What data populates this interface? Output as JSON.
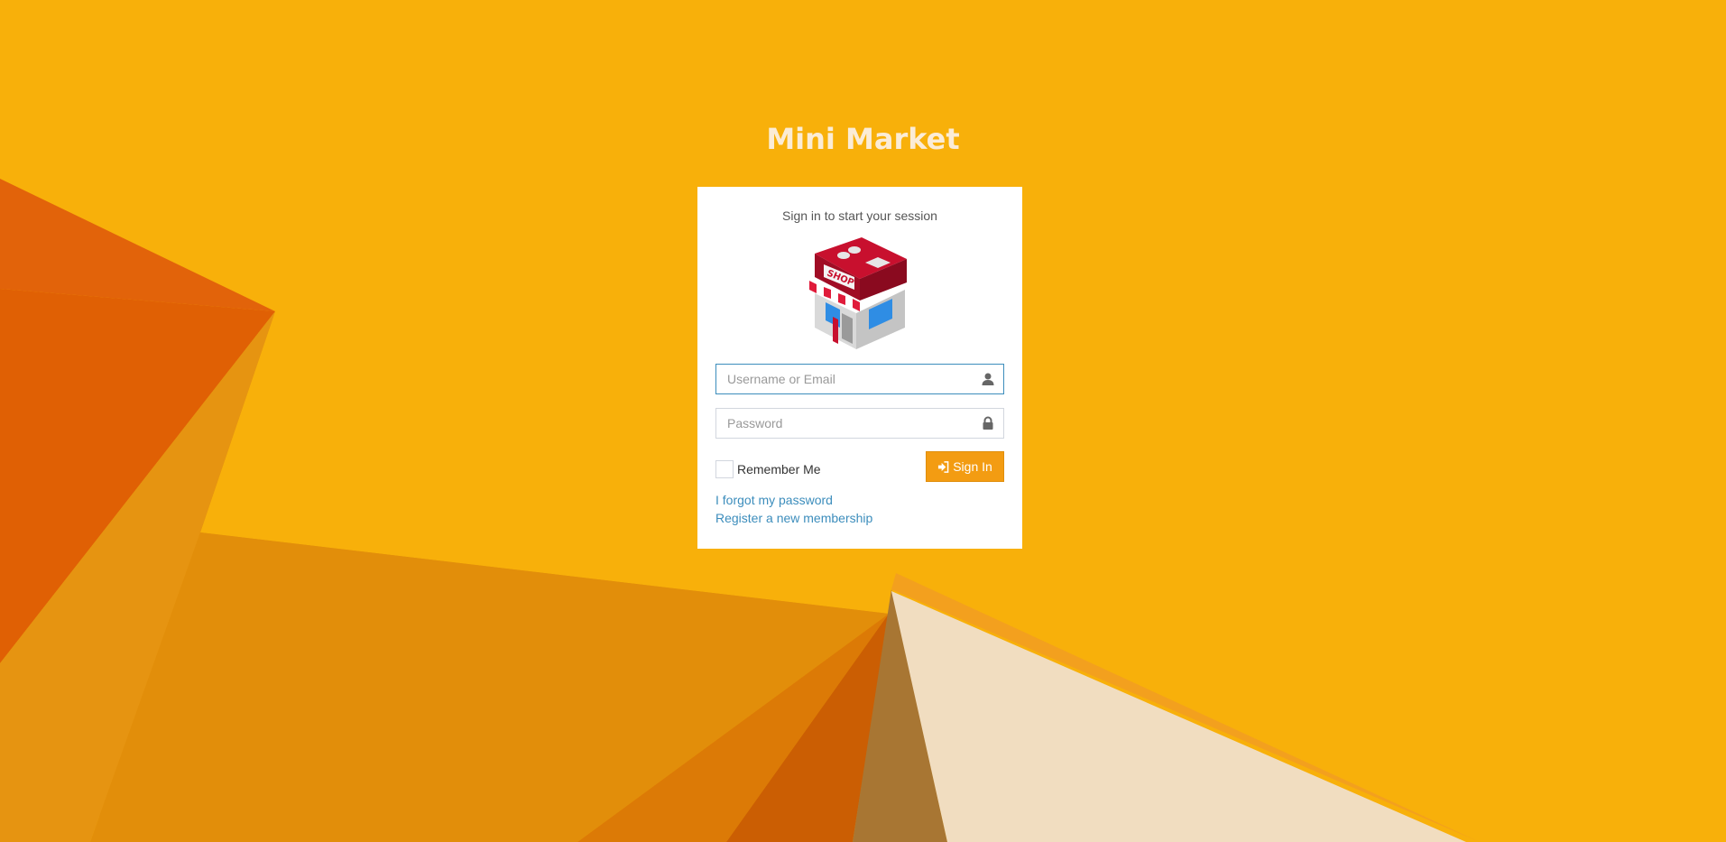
{
  "app": {
    "title": "Mini Market"
  },
  "login": {
    "message": "Sign in to start your session",
    "logo_sign": "SHOP",
    "username": {
      "placeholder": "Username or Email",
      "value": "",
      "icon": "user-icon"
    },
    "password": {
      "placeholder": "Password",
      "value": "",
      "icon": "lock-icon"
    },
    "remember_label": "Remember Me",
    "remember_checked": false,
    "signin_label": "Sign In",
    "signin_icon": "sign-in-icon",
    "forgot_link": "I forgot my password",
    "register_link": "Register a new membership"
  },
  "colors": {
    "background": "#f8b00a",
    "button": "#f39c12",
    "link": "#3c8dbc",
    "input_focus": "#3c8dbc"
  }
}
